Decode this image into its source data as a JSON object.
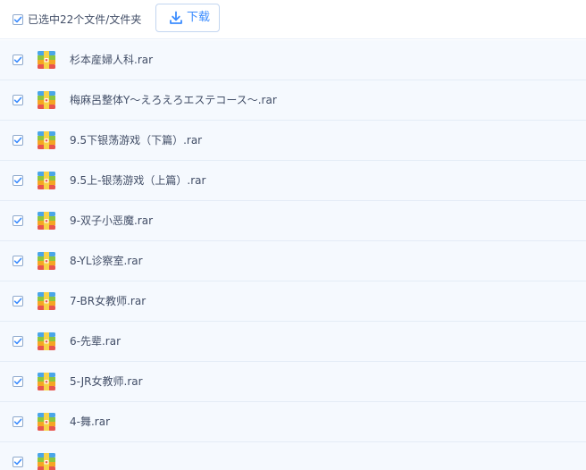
{
  "toolbar": {
    "selection_label": "已选中22个文件/文件夹",
    "download_label": "下载",
    "download_icon": "download-icon",
    "select_all_checked": true
  },
  "colors": {
    "accent": "#3b8cff",
    "row_background": "#f5f9fe",
    "row_border": "#e4ecf6",
    "text": "#424e67",
    "checkbox_border": "#8fa9cc",
    "rar_icon_blue": "#4aa6e8",
    "rar_icon_green": "#8cc63f",
    "rar_icon_orange": "#f5a623",
    "rar_icon_red": "#e8554e",
    "rar_icon_yellow": "#f7d248"
  },
  "files": [
    {
      "name": "杉本産婦人科.rar",
      "icon": "rar-archive-icon",
      "checked": true
    },
    {
      "name": "梅麻呂整体Y～えろえろエステコース～.rar",
      "icon": "rar-archive-icon",
      "checked": true
    },
    {
      "name": "9.5下银荡游戏（下篇）.rar",
      "icon": "rar-archive-icon",
      "checked": true
    },
    {
      "name": "9.5上-银荡游戏（上篇）.rar",
      "icon": "rar-archive-icon",
      "checked": true
    },
    {
      "name": "9-双子小恶魔.rar",
      "icon": "rar-archive-icon",
      "checked": true
    },
    {
      "name": "8-YL诊察室.rar",
      "icon": "rar-archive-icon",
      "checked": true
    },
    {
      "name": "7-BR女教师.rar",
      "icon": "rar-archive-icon",
      "checked": true
    },
    {
      "name": "6-先辈.rar",
      "icon": "rar-archive-icon",
      "checked": true
    },
    {
      "name": "5-JR女教师.rar",
      "icon": "rar-archive-icon",
      "checked": true
    },
    {
      "name": "4-舞.rar",
      "icon": "rar-archive-icon",
      "checked": true
    },
    {
      "name": "",
      "icon": "rar-archive-icon",
      "checked": true
    }
  ]
}
